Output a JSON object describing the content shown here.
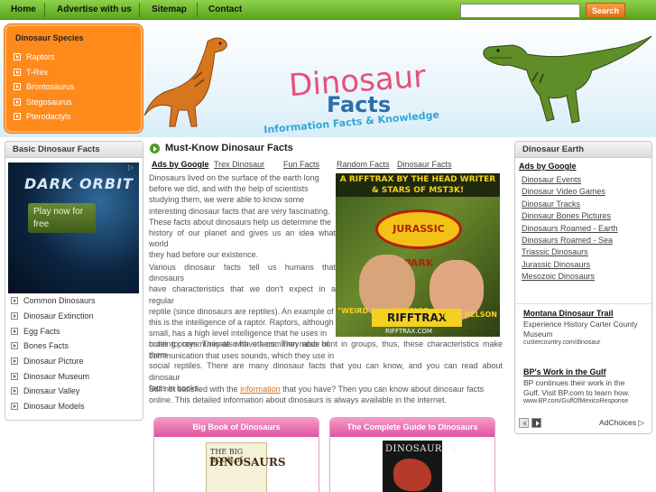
{
  "nav": {
    "items": [
      "Home",
      "Advertise with us",
      "Sitemap",
      "Contact"
    ],
    "search_button": "Search",
    "search_value": ""
  },
  "species": {
    "title": "Dinosaur Species",
    "items": [
      "Raptors",
      "T-Rex",
      "Brontosaurus",
      "Stegosaurus",
      "Pterodactyls"
    ]
  },
  "logo": {
    "title": "Dinosaur",
    "subtitle": "Facts",
    "tagline": "Information Facts & Knowledge"
  },
  "left": {
    "title": "Basic Dinosaur Facts",
    "ad": {
      "game_title": "DARK ORBIT",
      "cta": "Play now for free"
    },
    "items": [
      "Common Dinosaurs",
      "Dinosaur Extinction",
      "Egg Facts",
      "Bones Facts",
      "Dinosaur Picture",
      "Dinosaur Museum",
      "Dinosaur Valley",
      "Dinosaur Models"
    ]
  },
  "main": {
    "title": "Must-Know Dinosaur Facts",
    "ads_label": "Ads by Google",
    "ad_links": [
      "Trex Dinosaur",
      "Fun Facts",
      "Random Facts",
      "Dinosaur Facts"
    ],
    "para1_lines": [
      "Dinosaurs lived on the surface of the earth long",
      "before we did, and with the help of scientists",
      "studying them, we were able to know some",
      "interesting dinosaur facts that are very fascinating.",
      "These facts about dinosaurs help us determine the",
      "history of our planet and gives us an idea what world",
      "they had before our existence."
    ],
    "para2_lines": [
      "Various dinosaur facts tell us humans that dinosaurs",
      "have characteristics that we don't expect in a regular",
      "reptile (since dinosaurs are reptiles). An example of",
      "this is the intelligence of a raptor. Raptors, although",
      "small, has a high level intelligence that he uses in",
      "hunting preys. They also have a common mode of",
      "communication that uses sounds, which they use in",
      "order to communicate with others. They also hunt in groups, thus, these characteristics make them",
      "social reptiles. There are many dinosaur facts that you can know, and you can read about dinosaur",
      "facts in books."
    ],
    "para3_before": "Still not satisfied with the ",
    "para3_link": "information",
    "para3_after": " that you have? Then you can know about dinosaur facts",
    "para3_line2": "online. This detailed information about dinosaurs is always available in the internet.",
    "big_ad": {
      "top": "A RIFFTRAX BY THE HEAD WRITER & STARS OF MST3K!",
      "badge": "JURASSIC PARK",
      "brand": "RIFFTRAX",
      "left_name": "\"WEIRD AL\" YANKOVIC",
      "right_name": "MIKE NELSON",
      "url": "RIFFTRAX.COM"
    },
    "books": [
      {
        "title": "Big Book of Dinosaurs",
        "cover_top": "THE BIG BOOK of",
        "cover_main": "DINOSAURS"
      },
      {
        "title": "The Complete Guide to Dinosaurs",
        "cover_main": "DINOSAURUS"
      }
    ]
  },
  "right": {
    "title": "Dinosaur Earth",
    "ads_label": "Ads by Google",
    "links": [
      "Dinosaur Events",
      "Dinosaur Video Games",
      "Dinosaur Tracks",
      "Dinosaur Bones Pictures",
      "Dinosaurs Roamed - Earth",
      "Dinosaurs Roamed - Sea",
      "Triassic Dinosaurs",
      "Jurassic Dinosaurs",
      "Mesozoic Dinosaurs"
    ],
    "sponsors": [
      {
        "title": "Montana Dinosaur Trail",
        "text_lines": [
          "Experience History Carter County",
          "Museum"
        ],
        "url": "custercountry.com/dinosaur"
      },
      {
        "title": "BP's Work in the Gulf",
        "text_lines": [
          "BP continues their work in the",
          "Gulf. Visit BP.com to learn how."
        ],
        "url": "www.BP.com/GulfOfMexicoResponse"
      }
    ],
    "adchoices": "AdChoices"
  },
  "colors": {
    "nav_green": "#6bb52a",
    "species_orange": "#ff8a1c",
    "book_pink": "#e0559f",
    "logo_pink": "#e8507a",
    "logo_blue": "#2c6fa8"
  }
}
